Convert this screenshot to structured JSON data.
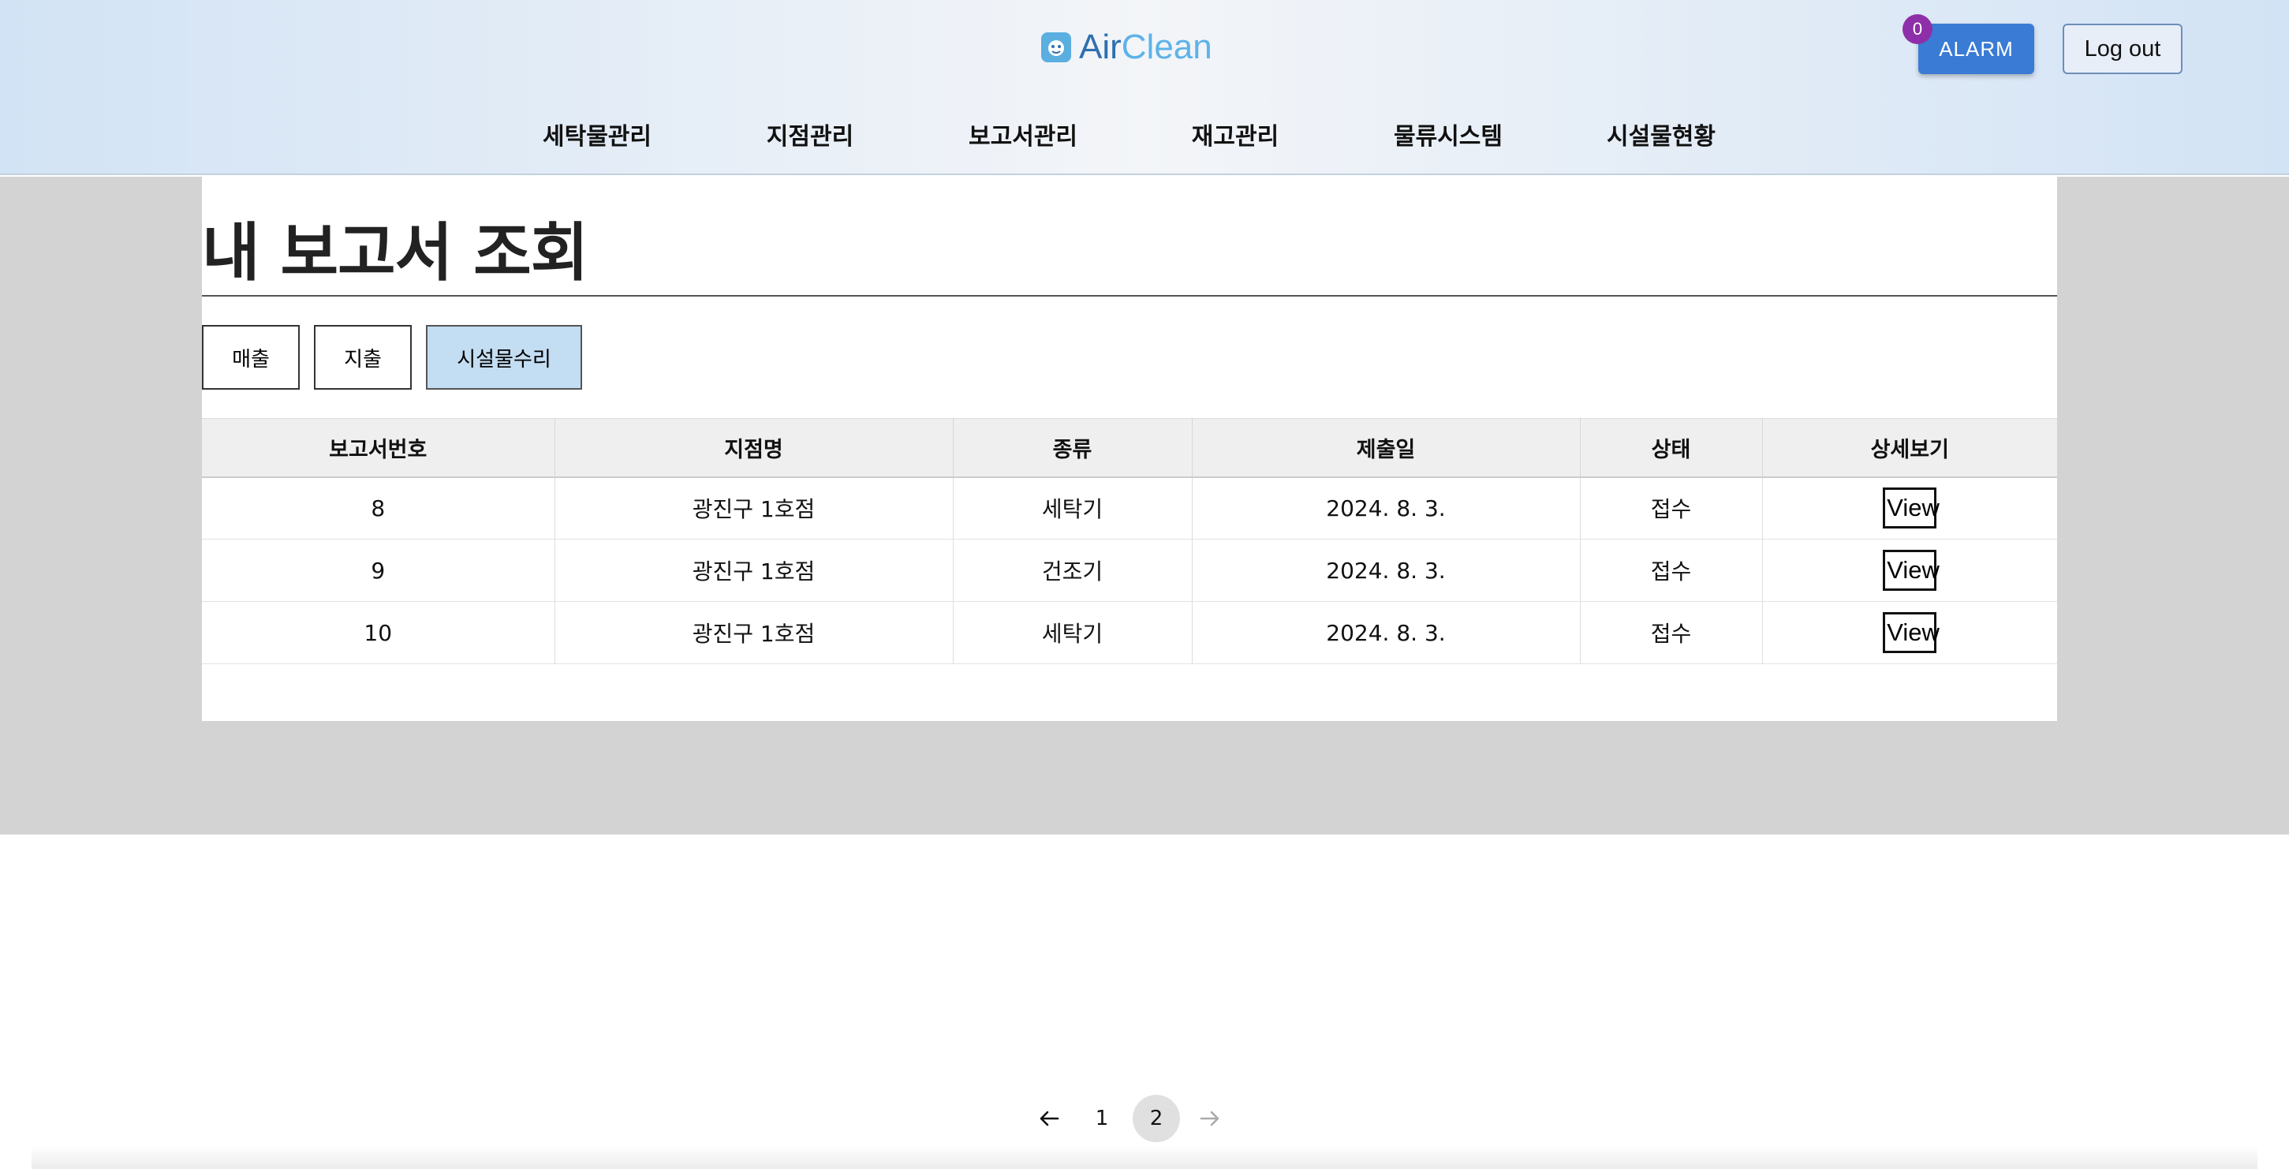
{
  "header": {
    "logo_part1": "Air",
    "logo_part2": "Clean",
    "alarm_label": "ALARM",
    "alarm_count": "0",
    "logout_label": "Log out"
  },
  "nav": {
    "items": [
      {
        "label": "세탁물관리"
      },
      {
        "label": "지점관리"
      },
      {
        "label": "보고서관리"
      },
      {
        "label": "재고관리"
      },
      {
        "label": "물류시스템"
      },
      {
        "label": "시설물현황"
      }
    ]
  },
  "page": {
    "title": "내 보고서 조회"
  },
  "filters": [
    {
      "label": "매출",
      "active": false
    },
    {
      "label": "지출",
      "active": false
    },
    {
      "label": "시설물수리",
      "active": true
    }
  ],
  "table": {
    "headers": [
      "보고서번호",
      "지점명",
      "종류",
      "제출일",
      "상태",
      "상세보기"
    ],
    "rows": [
      {
        "id": "8",
        "branch": "광진구 1호점",
        "type": "세탁기",
        "date": "2024. 8. 3.",
        "status": "접수",
        "action": "View"
      },
      {
        "id": "9",
        "branch": "광진구 1호점",
        "type": "건조기",
        "date": "2024. 8. 3.",
        "status": "접수",
        "action": "View"
      },
      {
        "id": "10",
        "branch": "광진구 1호점",
        "type": "세탁기",
        "date": "2024. 8. 3.",
        "status": "접수",
        "action": "View"
      }
    ]
  },
  "pagination": {
    "prev_icon": "arrow-left-icon",
    "next_icon": "arrow-right-icon",
    "pages": [
      "1",
      "2"
    ],
    "current": "2"
  },
  "colors": {
    "accent": "#3a7bd5",
    "badge": "#8e2fa9",
    "active_filter": "#c3ddf2",
    "content_bg": "#d3d3d3"
  }
}
